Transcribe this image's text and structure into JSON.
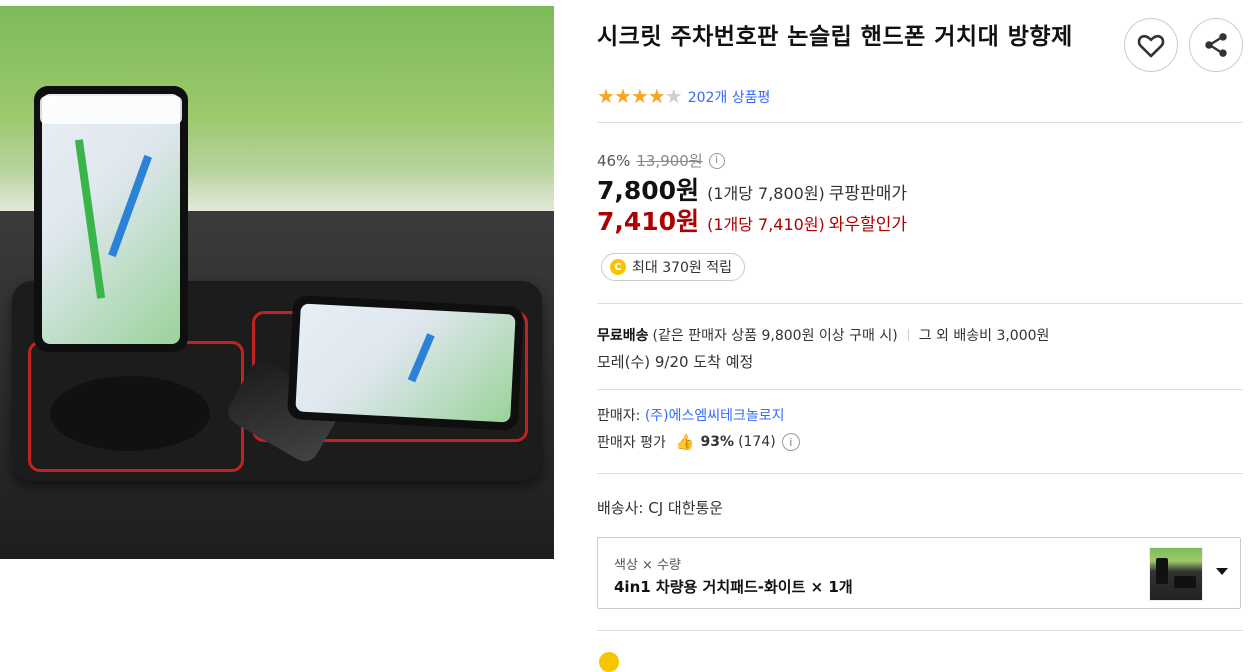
{
  "product": {
    "title": "시크릿 주차번호판 논슬립 핸드폰 거치대 방향제",
    "rating_stars": 4,
    "rating_max": 5,
    "review_count_text": "202개 상품평"
  },
  "pricing": {
    "discount_rate": "46%",
    "original_price": "13,900원",
    "sale_price": "7,800원",
    "sale_unit_price": "(1개당 7,800원)",
    "sale_label": "쿠팡판매가",
    "wow_price": "7,410원",
    "wow_unit_price": "(1개당 7,410원)",
    "wow_label": "와우할인가",
    "reward_coin": "C",
    "reward_text": "최대 370원 적립"
  },
  "shipping": {
    "free_label": "무료배송",
    "free_condition": "(같은 판매자 상품 9,800원 이상 구매 시)",
    "other_fee": "그 외 배송비 3,000원",
    "arrival": "모레(수) 9/20 도착 예정"
  },
  "seller": {
    "label": "판매자:",
    "name": "(주)에스엠씨테크놀로지",
    "rating_label": "판매자 평가",
    "rating_percent": "93%",
    "rating_count": "(174)"
  },
  "carrier": {
    "text": "배송사: CJ 대한통운"
  },
  "option": {
    "label": "색상 × 수량",
    "value": "4in1 차량용 거치패드-화이트 × 1개"
  },
  "icons": {
    "wishlist": "heart-icon",
    "share": "share-icon",
    "info": "info-icon",
    "thumbs_up": "thumbs-up-icon",
    "dropdown": "chevron-down-icon",
    "info_glyph": "i",
    "thumb_glyph": "👍"
  },
  "colors": {
    "star": "#f5a623",
    "link": "#346aff",
    "wow_price": "#ae0000",
    "coin": "#f6c500"
  }
}
